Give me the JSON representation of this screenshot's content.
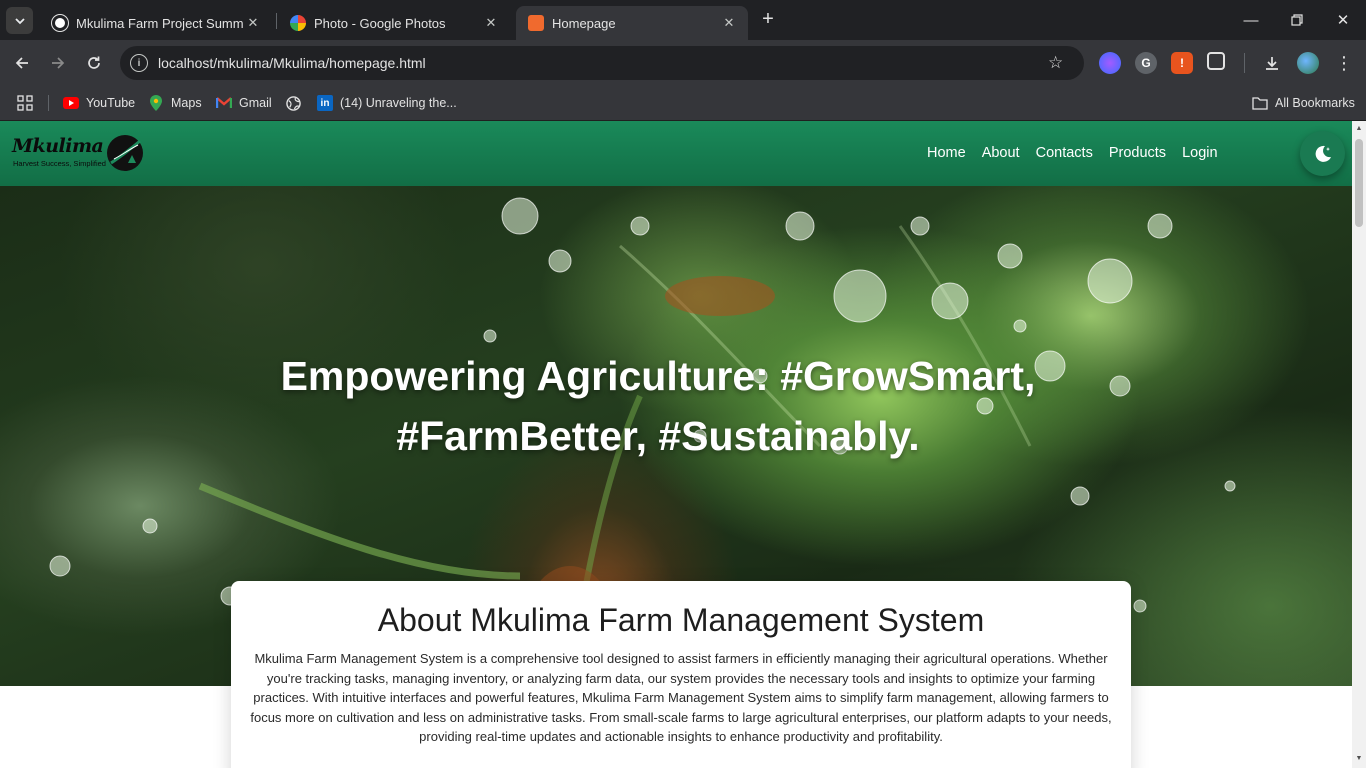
{
  "browser": {
    "tabs": [
      {
        "title": "Mkulima Farm Project Summary",
        "active": false
      },
      {
        "title": "Photo - Google Photos",
        "active": false
      },
      {
        "title": "Homepage",
        "active": true
      }
    ],
    "url": "localhost/mkulima/Mkulima/homepage.html",
    "bookmarks": [
      {
        "label": "YouTube",
        "icon": "youtube-icon"
      },
      {
        "label": "Maps",
        "icon": "maps-icon"
      },
      {
        "label": "Gmail",
        "icon": "gmail-icon"
      },
      {
        "label": "",
        "icon": "globe-icon"
      },
      {
        "label": "(14) Unraveling the...",
        "icon": "linkedin-icon"
      }
    ],
    "all_bookmarks": "All Bookmarks"
  },
  "site": {
    "logo_text": "Mkulima",
    "logo_tagline": "Harvest Success, Simplified",
    "nav": [
      "Home",
      "About",
      "Contacts",
      "Products",
      "Login"
    ],
    "theme_toggle_icon": "moon-icon",
    "accent_color": "#138055"
  },
  "hero": {
    "title": "Empowering Agriculture: #GrowSmart, #FarmBetter, #Sustainably."
  },
  "about": {
    "title": "About Mkulima Farm Management System",
    "text": "Mkulima Farm Management System is a comprehensive tool designed to assist farmers in efficiently managing their agricultural operations. Whether you're tracking tasks, managing inventory, or analyzing farm data, our system provides the necessary tools and insights to optimize your farming practices. With intuitive interfaces and powerful features, Mkulima Farm Management System aims to simplify farm management, allowing farmers to focus more on cultivation and less on administrative tasks. From small-scale farms to large agricultural enterprises, our platform adapts to your needs, providing real-time updates and actionable insights to enhance productivity and profitability."
  }
}
